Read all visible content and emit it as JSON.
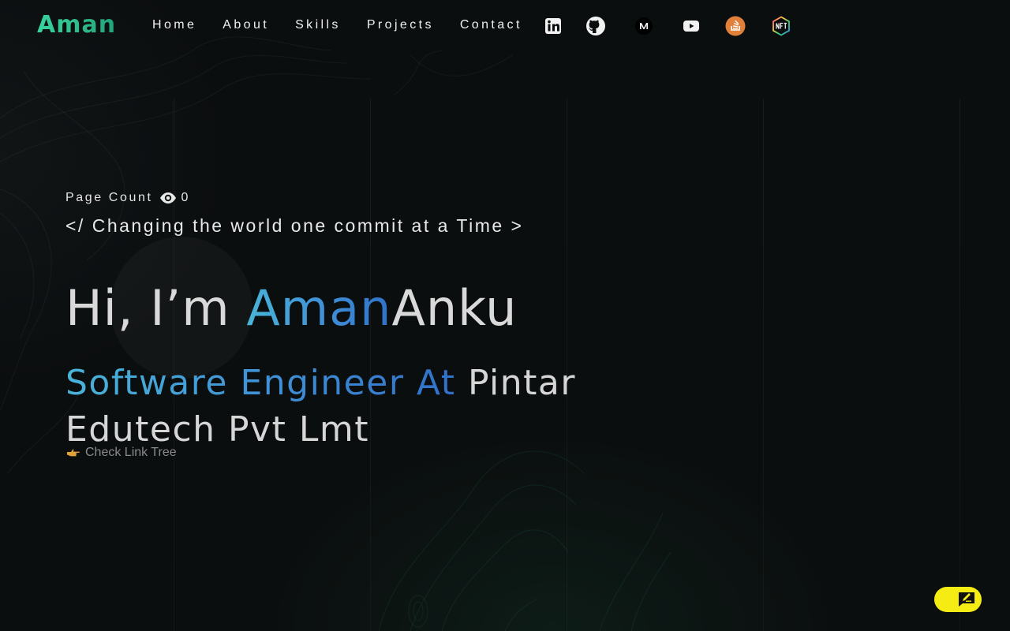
{
  "nav": {
    "logo": "Aman",
    "links": [
      "Home",
      "About",
      "Skills",
      "Projects",
      "Contact"
    ],
    "socials": [
      "linkedin-icon",
      "github-icon",
      "medium-icon",
      "youtube-icon",
      "stackoverflow-icon",
      "nft-icon"
    ]
  },
  "hero": {
    "page_count_label": "Page Count",
    "page_count_value": "0",
    "tagline": "</ Changing the world one commit at a Time >",
    "greeting": "Hi, I’m ",
    "first_name": "Aman",
    "last_name": "Anku",
    "role_highlight": "Software Engineer At",
    "role_rest": " Pintar Edutech Pvt Lmt",
    "linktree_label": "Check Link Tree"
  },
  "colors": {
    "logo": "#38d39f",
    "accent_blue": "#3f8fd6",
    "feedback": "#f4ec12",
    "background": "#0b0e0f"
  }
}
